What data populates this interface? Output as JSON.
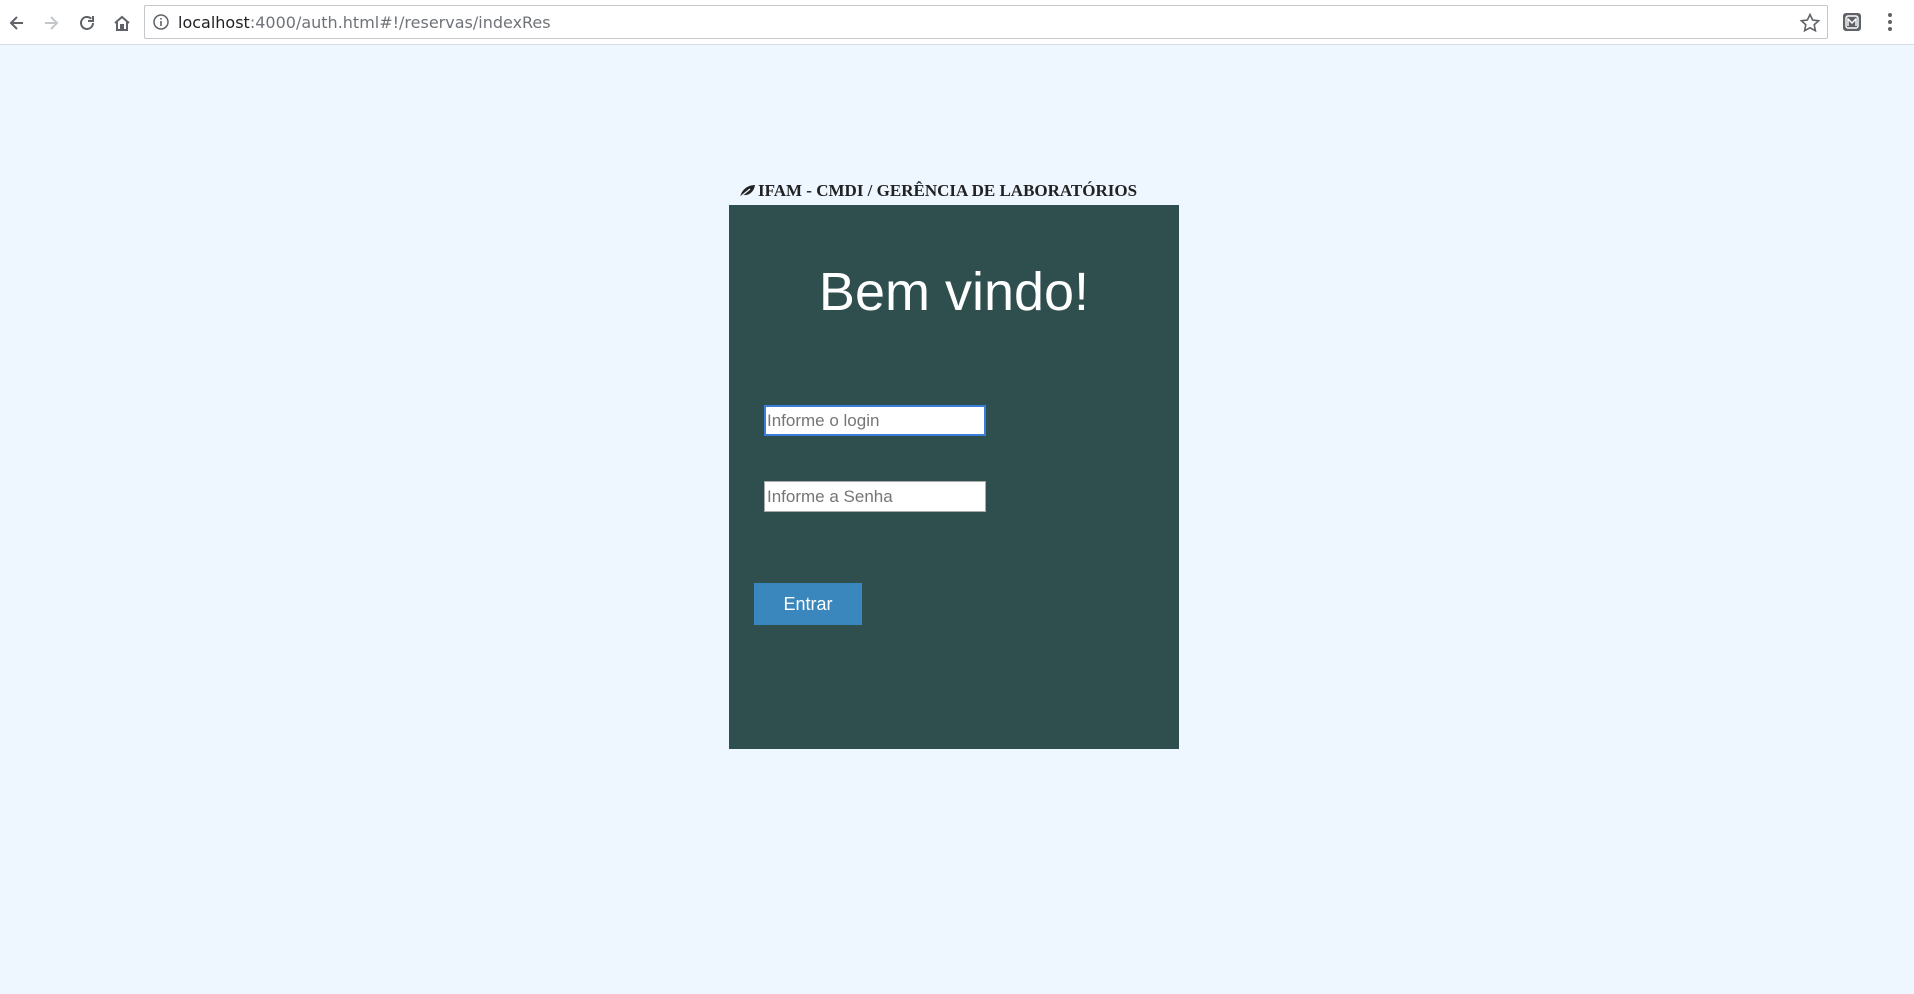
{
  "browser": {
    "url_host": "localhost",
    "url_path": ":4000/auth.html#!/reservas/indexRes"
  },
  "page": {
    "header": "IFAM - CMDI / GERÊNCIA DE LABORATÓRIOS",
    "welcome": "Bem vindo!",
    "login_placeholder": "Informe o login",
    "password_placeholder": "Informe a Senha",
    "submit_label": "Entrar"
  },
  "colors": {
    "page_background": "#eef6ff",
    "card_background": "#2f4f4f",
    "button_background": "#3a87bd",
    "focus_border": "#3b7dd8"
  },
  "icons": {
    "header_icon": "leaf-icon",
    "browser": [
      "back-icon",
      "forward-icon",
      "reload-icon",
      "home-icon",
      "info-icon",
      "star-icon",
      "extension-icon",
      "menu-icon"
    ]
  }
}
